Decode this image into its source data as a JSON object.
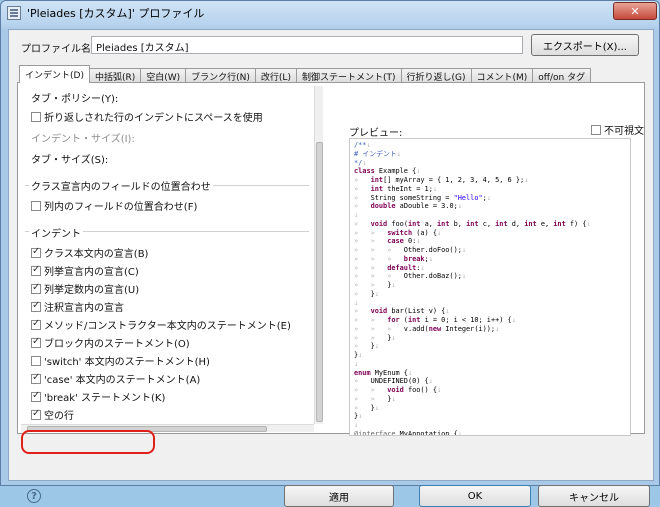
{
  "window": {
    "title": "'Pleiades [カスタム]' プロファイル",
    "min_glyph": "─",
    "max_glyph": "□",
    "close_glyph": "✕"
  },
  "profile": {
    "label": "プロファイル名(P):",
    "value": "Pleiades [カスタム]",
    "export_label": "エクスポート(X)..."
  },
  "tabs": [
    {
      "label": "インデント(D)",
      "active": true
    },
    {
      "label": "中括弧(R)"
    },
    {
      "label": "空白(W)"
    },
    {
      "label": "ブランク行(N)"
    },
    {
      "label": "改行(L)"
    },
    {
      "label": "制御ステートメント(T)"
    },
    {
      "label": "行折り返し(G)"
    },
    {
      "label": "コメント(M)"
    },
    {
      "label": "off/on タグ"
    }
  ],
  "general": {
    "tab_policy_label": "タブ・ポリシー(Y):",
    "wrapped_indent_label": "折り返しされた行のインデントにスペースを使用",
    "indent_size_label": "インデント・サイズ(I):",
    "tab_size_label": "タブ・サイズ(S):"
  },
  "field_align": {
    "group_title": "クラス宣言内のフィールドの位置合わせ",
    "align_label": "列内のフィールドの位置合わせ(F)"
  },
  "indent": {
    "group_title": "インデント",
    "items": [
      {
        "label": "クラス本文内の宣言(B)",
        "checked": true
      },
      {
        "label": "列挙宣言内の宣言(C)",
        "checked": true
      },
      {
        "label": "列挙定数内の宣言(U)",
        "checked": true
      },
      {
        "label": "注釈宣言内の宣言",
        "checked": true
      },
      {
        "label": "メソッド/コンストラクター本文内のステートメント(E)",
        "checked": true
      },
      {
        "label": "ブロック内のステートメント(O)",
        "checked": true
      },
      {
        "label": "'switch' 本文内のステートメント(H)",
        "checked": false
      },
      {
        "label": "'case' 本文内のステートメント(A)",
        "checked": true
      },
      {
        "label": "'break' ステートメント(K)",
        "checked": true
      },
      {
        "label": "空の行",
        "checked": true
      }
    ]
  },
  "preview": {
    "label": "プレビュー:",
    "wrap_label": "不可視文"
  },
  "footer": {
    "help_glyph": "?",
    "apply_label": "適用",
    "ok_label": "OK",
    "cancel_label": "キャンセル"
  },
  "colors": {
    "annotation": "#e0201a",
    "keyword": "#7f0055",
    "comment": "#3f5fbf",
    "string": "#2a00ff"
  }
}
